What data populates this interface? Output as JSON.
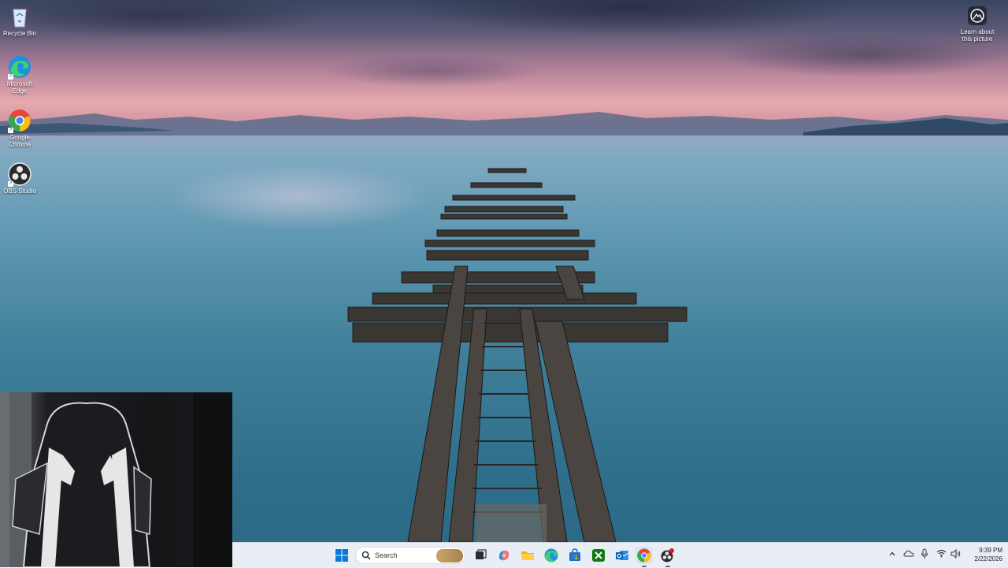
{
  "desktop": {
    "icons": [
      {
        "label": "Recycle Bin",
        "icon": "recycle-bin-icon"
      },
      {
        "label": "Microsoft Edge",
        "icon": "edge-icon"
      },
      {
        "label": "Google Chrome",
        "icon": "chrome-icon"
      },
      {
        "label": "OBS Studio",
        "icon": "obs-icon"
      }
    ],
    "learn_about_picture": "Learn about this picture"
  },
  "taskbar": {
    "search_label": "Search",
    "pinned": [
      {
        "name": "start",
        "icon": "windows-start-icon"
      },
      {
        "name": "task-view",
        "icon": "task-view-icon"
      },
      {
        "name": "copilot",
        "icon": "copilot-icon"
      },
      {
        "name": "file-explorer",
        "icon": "folder-icon"
      },
      {
        "name": "edge",
        "icon": "edge-icon"
      },
      {
        "name": "store",
        "icon": "store-icon"
      },
      {
        "name": "xbox",
        "icon": "xbox-icon"
      },
      {
        "name": "outlook",
        "icon": "outlook-icon"
      },
      {
        "name": "chrome",
        "icon": "chrome-icon"
      },
      {
        "name": "obs",
        "icon": "obs-icon"
      }
    ],
    "tray": {
      "icons": [
        "chevron-up-icon",
        "onedrive-icon",
        "microphone-icon",
        "wifi-icon",
        "speaker-icon"
      ],
      "time": "9:39 PM",
      "date": "2/22/2026"
    }
  },
  "colors": {
    "taskbar_bg": "#e9eef5",
    "accent": "#0078d4"
  }
}
